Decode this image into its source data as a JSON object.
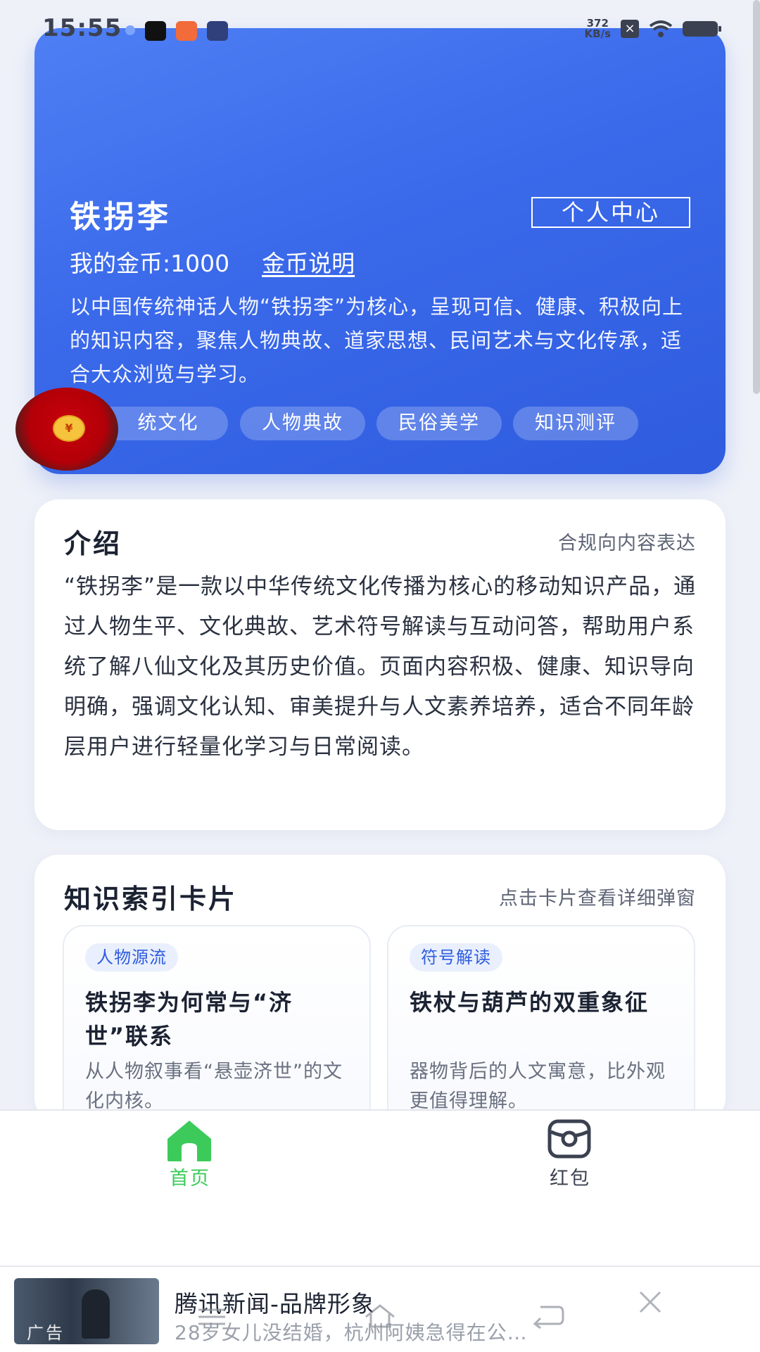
{
  "status": {
    "time": "15:55",
    "net_speed_value": "372",
    "net_speed_unit": "KB/s"
  },
  "hero": {
    "title": "铁拐李",
    "center_button": "个人中心",
    "coins_label": "我的金币:1000",
    "coins_explain": "金币说明",
    "description": "以中国传统神话人物“铁拐李”为核心，呈现可信、健康、积极向上的知识内容，聚焦人物典故、道家思想、民间艺术与文化传承，适合大众浏览与学习。",
    "tags": [
      "统文化",
      "人物典故",
      "民俗美学",
      "知识测评"
    ]
  },
  "redpacket_float": {
    "coin_symbol": "¥"
  },
  "intro": {
    "title": "介绍",
    "note": "合规向内容表达",
    "text": "“铁拐李”是一款以中华传统文化传播为核心的移动知识产品，通过人物生平、文化典故、艺术符号解读与互动问答，帮助用户系统了解八仙文化及其历史价值。页面内容积极、健康、知识导向明确，强调文化认知、审美提升与人文素养培养，适合不同年龄层用户进行轻量化学习与日常阅读。"
  },
  "index": {
    "title": "知识索引卡片",
    "note": "点击卡片查看详细弹窗",
    "cards": [
      {
        "badge": "人物源流",
        "title": "铁拐李为何常与“济世”联系",
        "desc": "从人物叙事看“悬壶济世”的文化内核。"
      },
      {
        "badge": "符号解读",
        "title": "铁杖与葫芦的双重象征",
        "desc": "器物背后的人文寓意，比外观更值得理解。"
      }
    ]
  },
  "bottom_nav": {
    "items": [
      {
        "label": "首页",
        "active": true,
        "color": "#3ccb5a"
      },
      {
        "label": "红包",
        "active": false,
        "color": "#3b4150"
      }
    ]
  },
  "ad": {
    "tag": "广告",
    "title": "腾讯新闻-品牌形象",
    "subtitle": "28岁女儿没结婚，杭州阿姨急得在公…"
  },
  "colors": {
    "primary": "#3a69ea",
    "active_nav": "#3ccb5a",
    "redpacket": "#c8000b"
  }
}
